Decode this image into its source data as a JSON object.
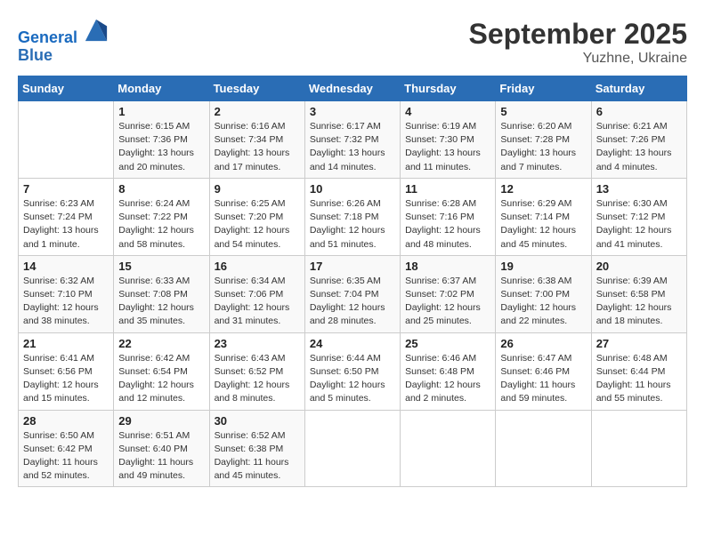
{
  "header": {
    "logo_line1": "General",
    "logo_line2": "Blue",
    "month": "September 2025",
    "location": "Yuzhne, Ukraine"
  },
  "days_of_week": [
    "Sunday",
    "Monday",
    "Tuesday",
    "Wednesday",
    "Thursday",
    "Friday",
    "Saturday"
  ],
  "weeks": [
    [
      {
        "day": "",
        "info": ""
      },
      {
        "day": "1",
        "info": "Sunrise: 6:15 AM\nSunset: 7:36 PM\nDaylight: 13 hours\nand 20 minutes."
      },
      {
        "day": "2",
        "info": "Sunrise: 6:16 AM\nSunset: 7:34 PM\nDaylight: 13 hours\nand 17 minutes."
      },
      {
        "day": "3",
        "info": "Sunrise: 6:17 AM\nSunset: 7:32 PM\nDaylight: 13 hours\nand 14 minutes."
      },
      {
        "day": "4",
        "info": "Sunrise: 6:19 AM\nSunset: 7:30 PM\nDaylight: 13 hours\nand 11 minutes."
      },
      {
        "day": "5",
        "info": "Sunrise: 6:20 AM\nSunset: 7:28 PM\nDaylight: 13 hours\nand 7 minutes."
      },
      {
        "day": "6",
        "info": "Sunrise: 6:21 AM\nSunset: 7:26 PM\nDaylight: 13 hours\nand 4 minutes."
      }
    ],
    [
      {
        "day": "7",
        "info": "Sunrise: 6:23 AM\nSunset: 7:24 PM\nDaylight: 13 hours\nand 1 minute."
      },
      {
        "day": "8",
        "info": "Sunrise: 6:24 AM\nSunset: 7:22 PM\nDaylight: 12 hours\nand 58 minutes."
      },
      {
        "day": "9",
        "info": "Sunrise: 6:25 AM\nSunset: 7:20 PM\nDaylight: 12 hours\nand 54 minutes."
      },
      {
        "day": "10",
        "info": "Sunrise: 6:26 AM\nSunset: 7:18 PM\nDaylight: 12 hours\nand 51 minutes."
      },
      {
        "day": "11",
        "info": "Sunrise: 6:28 AM\nSunset: 7:16 PM\nDaylight: 12 hours\nand 48 minutes."
      },
      {
        "day": "12",
        "info": "Sunrise: 6:29 AM\nSunset: 7:14 PM\nDaylight: 12 hours\nand 45 minutes."
      },
      {
        "day": "13",
        "info": "Sunrise: 6:30 AM\nSunset: 7:12 PM\nDaylight: 12 hours\nand 41 minutes."
      }
    ],
    [
      {
        "day": "14",
        "info": "Sunrise: 6:32 AM\nSunset: 7:10 PM\nDaylight: 12 hours\nand 38 minutes."
      },
      {
        "day": "15",
        "info": "Sunrise: 6:33 AM\nSunset: 7:08 PM\nDaylight: 12 hours\nand 35 minutes."
      },
      {
        "day": "16",
        "info": "Sunrise: 6:34 AM\nSunset: 7:06 PM\nDaylight: 12 hours\nand 31 minutes."
      },
      {
        "day": "17",
        "info": "Sunrise: 6:35 AM\nSunset: 7:04 PM\nDaylight: 12 hours\nand 28 minutes."
      },
      {
        "day": "18",
        "info": "Sunrise: 6:37 AM\nSunset: 7:02 PM\nDaylight: 12 hours\nand 25 minutes."
      },
      {
        "day": "19",
        "info": "Sunrise: 6:38 AM\nSunset: 7:00 PM\nDaylight: 12 hours\nand 22 minutes."
      },
      {
        "day": "20",
        "info": "Sunrise: 6:39 AM\nSunset: 6:58 PM\nDaylight: 12 hours\nand 18 minutes."
      }
    ],
    [
      {
        "day": "21",
        "info": "Sunrise: 6:41 AM\nSunset: 6:56 PM\nDaylight: 12 hours\nand 15 minutes."
      },
      {
        "day": "22",
        "info": "Sunrise: 6:42 AM\nSunset: 6:54 PM\nDaylight: 12 hours\nand 12 minutes."
      },
      {
        "day": "23",
        "info": "Sunrise: 6:43 AM\nSunset: 6:52 PM\nDaylight: 12 hours\nand 8 minutes."
      },
      {
        "day": "24",
        "info": "Sunrise: 6:44 AM\nSunset: 6:50 PM\nDaylight: 12 hours\nand 5 minutes."
      },
      {
        "day": "25",
        "info": "Sunrise: 6:46 AM\nSunset: 6:48 PM\nDaylight: 12 hours\nand 2 minutes."
      },
      {
        "day": "26",
        "info": "Sunrise: 6:47 AM\nSunset: 6:46 PM\nDaylight: 11 hours\nand 59 minutes."
      },
      {
        "day": "27",
        "info": "Sunrise: 6:48 AM\nSunset: 6:44 PM\nDaylight: 11 hours\nand 55 minutes."
      }
    ],
    [
      {
        "day": "28",
        "info": "Sunrise: 6:50 AM\nSunset: 6:42 PM\nDaylight: 11 hours\nand 52 minutes."
      },
      {
        "day": "29",
        "info": "Sunrise: 6:51 AM\nSunset: 6:40 PM\nDaylight: 11 hours\nand 49 minutes."
      },
      {
        "day": "30",
        "info": "Sunrise: 6:52 AM\nSunset: 6:38 PM\nDaylight: 11 hours\nand 45 minutes."
      },
      {
        "day": "",
        "info": ""
      },
      {
        "day": "",
        "info": ""
      },
      {
        "day": "",
        "info": ""
      },
      {
        "day": "",
        "info": ""
      }
    ]
  ]
}
